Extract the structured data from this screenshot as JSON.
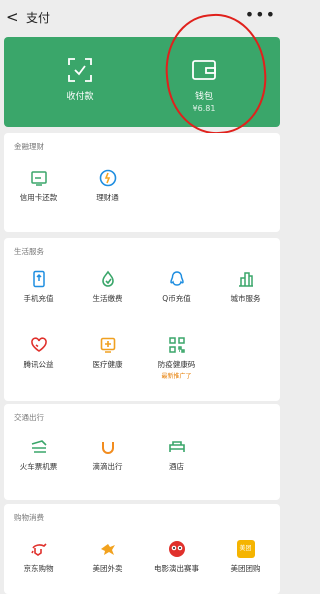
{
  "header": {
    "back_glyph": "<",
    "title": "支付",
    "more_glyph": "•••"
  },
  "hero": {
    "receive_label": "收付款",
    "wallet_label": "钱包",
    "wallet_balance": "¥6.81",
    "accent": "#3aa66a"
  },
  "finance": {
    "title": "金融理财",
    "items": [
      {
        "label": "信用卡还款",
        "icon": "credit-card-icon"
      },
      {
        "label": "理财通",
        "icon": "wealth-icon"
      }
    ]
  },
  "life": {
    "title": "生活服务",
    "items": [
      {
        "label": "手机充值",
        "icon": "phone-topup-icon"
      },
      {
        "label": "生活缴费",
        "icon": "utility-bill-icon"
      },
      {
        "label": "Q币充值",
        "icon": "qq-coin-icon"
      },
      {
        "label": "城市服务",
        "icon": "city-service-icon"
      },
      {
        "label": "腾讯公益",
        "icon": "charity-icon"
      },
      {
        "label": "医疗健康",
        "icon": "medical-icon"
      },
      {
        "label": "防疫健康码",
        "icon": "health-code-icon",
        "sub": "最新推广了"
      }
    ]
  },
  "transport": {
    "title": "交通出行",
    "items": [
      {
        "label": "火车票机票",
        "icon": "train-ticket-icon"
      },
      {
        "label": "滴滴出行",
        "icon": "didi-icon"
      },
      {
        "label": "酒店",
        "icon": "hotel-icon"
      }
    ]
  },
  "shopping": {
    "title": "购物消费",
    "items": [
      {
        "label": "京东购物",
        "icon": "jd-icon"
      },
      {
        "label": "美团外卖",
        "icon": "meituan-waimai-icon"
      },
      {
        "label": "电影演出赛事",
        "icon": "movie-icon"
      },
      {
        "label": "美团团购",
        "icon": "meituan-group-icon",
        "badge": "美团"
      }
    ]
  }
}
